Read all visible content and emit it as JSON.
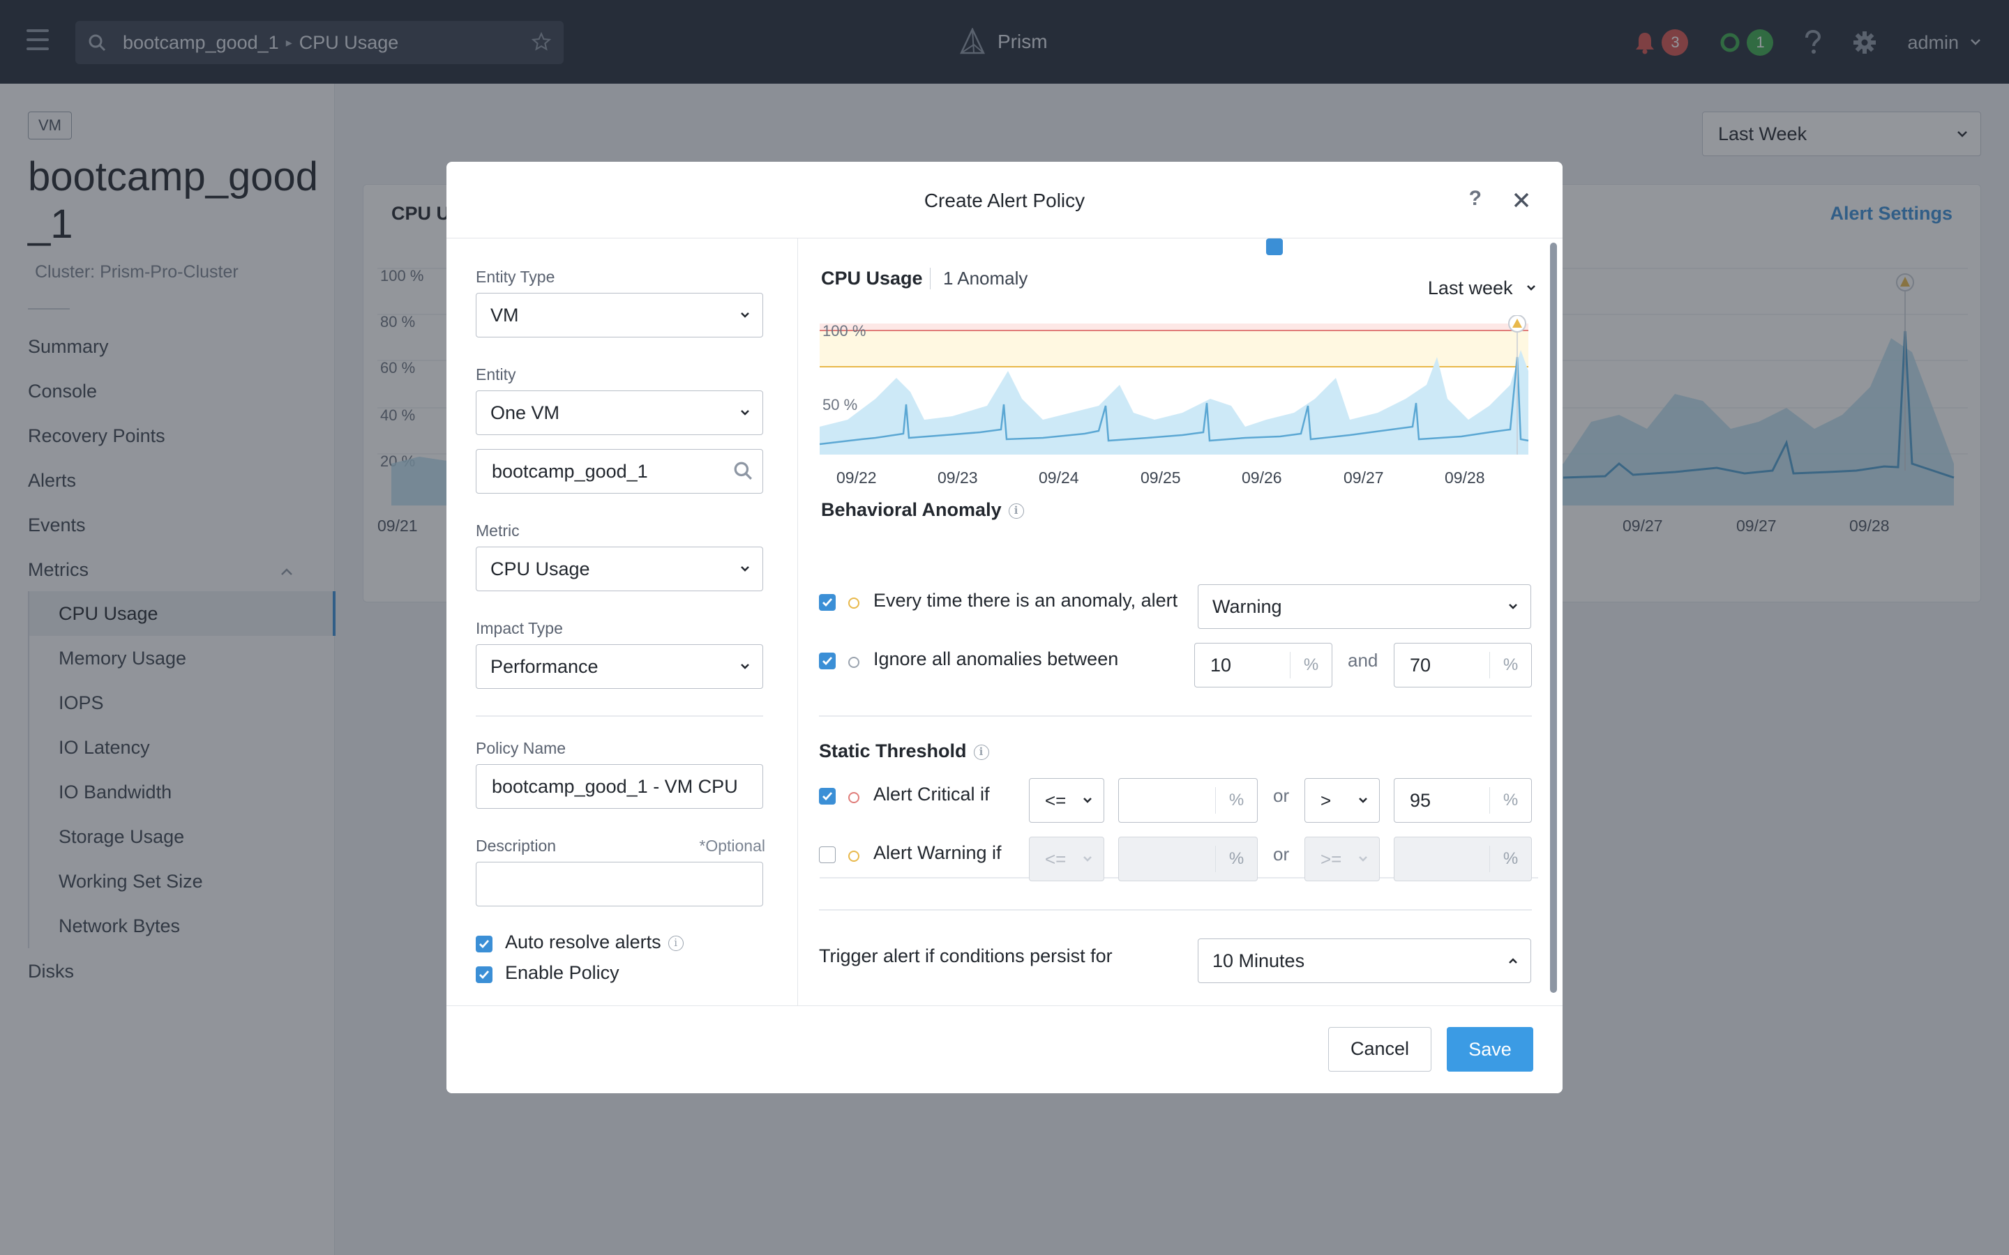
{
  "topbar": {
    "breadcrumb": [
      "bootcamp_good_1",
      "CPU Usage"
    ],
    "brand": "Prism",
    "alerts_count": "3",
    "tasks_count": "1",
    "user": "admin"
  },
  "sidebar": {
    "entity_tag": "VM",
    "title": "bootcamp_good_1",
    "cluster": "Cluster: Prism-Pro-Cluster",
    "nav": [
      "Summary",
      "Console",
      "Recovery Points",
      "Alerts",
      "Events",
      "Metrics"
    ],
    "metrics": [
      "CPU Usage",
      "Memory Usage",
      "IOPS",
      "IO Latency",
      "IO Bandwidth",
      "Storage Usage",
      "Working Set Size",
      "Network Bytes"
    ],
    "disks": "Disks"
  },
  "background": {
    "range": "Last Week",
    "card_title": "CPU U",
    "alert_settings": "Alert Settings",
    "y_ticks": [
      "100 %",
      "80 %",
      "60 %",
      "40 %",
      "20 %"
    ],
    "x_ticks": [
      "09/21",
      "09/27",
      "09/27",
      "09/28"
    ]
  },
  "modal": {
    "title": "Create Alert Policy",
    "help": "?",
    "entity_type_label": "Entity Type",
    "entity_type": "VM",
    "entity_label": "Entity",
    "entity": "One VM",
    "entity_search_value": "bootcamp_good_1",
    "metric_label": "Metric",
    "metric": "CPU Usage",
    "impact_label": "Impact Type",
    "impact": "Performance",
    "policy_name_label": "Policy Name",
    "policy_name": "bootcamp_good_1 - VM CPU",
    "description_label": "Description",
    "optional": "*Optional",
    "auto_resolve": "Auto resolve alerts",
    "enable_policy": "Enable Policy",
    "chart": {
      "metric_title": "CPU Usage",
      "anomaly_count": "1 Anomaly",
      "range": "Last week",
      "y_label_top": "100 %",
      "y_label_mid": "50 %",
      "x_ticks": [
        "09/22",
        "09/23",
        "09/24",
        "09/25",
        "09/26",
        "09/27",
        "09/28"
      ]
    },
    "behavioral": {
      "title": "Behavioral Anomaly",
      "every_time": "Every time there is an anomaly, alert",
      "severity": "Warning",
      "ignore": "Ignore all anomalies between",
      "ignore_low": "10",
      "ignore_high": "70",
      "and": "and",
      "pct": "%"
    },
    "static": {
      "title": "Static Threshold",
      "critical_label": "Alert Critical if",
      "critical_op1": "<=",
      "critical_val1": "",
      "critical_op2": ">",
      "critical_val2": "95",
      "warning_label": "Alert Warning if",
      "warning_op1": "<=",
      "warning_op2": ">=",
      "or": "or",
      "pct": "%"
    },
    "trigger": {
      "label": "Trigger alert if conditions persist for",
      "value": "10 Minutes"
    },
    "cancel": "Cancel",
    "save": "Save"
  }
}
